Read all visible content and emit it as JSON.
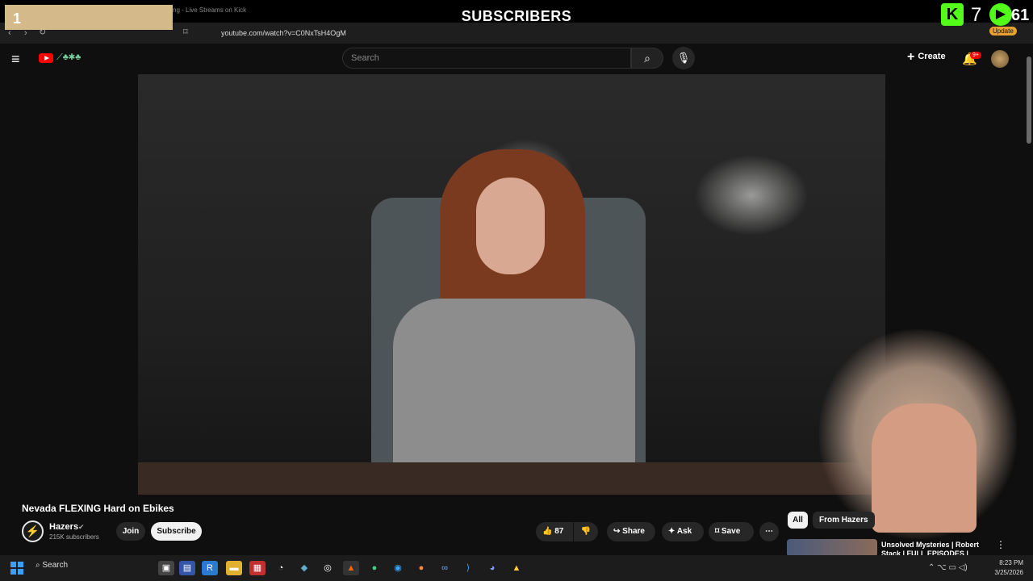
{
  "overlay": {
    "left_value": "1",
    "title": "SUBSCRIBERS",
    "kick_count": "7",
    "play_count": "61"
  },
  "browser": {
    "tab_title": "ng - Live Streams on Kick",
    "url": "youtube.com/watch?v=C0NxTsH4OgM",
    "update_label": "Update"
  },
  "header": {
    "search_placeholder": "Search",
    "create_label": "Create",
    "notification_badge": "9+"
  },
  "video": {
    "title": "Nevada FLEXING Hard on Ebikes"
  },
  "channel": {
    "name": "Hazers",
    "subscribers": "215K subscribers",
    "join_label": "Join",
    "subscribe_label": "Subscribe"
  },
  "actions": {
    "likes": "87",
    "share_label": "Share",
    "ask_label": "Ask",
    "save_label": "Save"
  },
  "recommendations": {
    "chips": [
      "All",
      "From Hazers"
    ],
    "first_title": "Unsolved Mysteries | Robert Stack | FULL EPISODES |"
  },
  "taskbar": {
    "search_label": "Search",
    "time": "8:23 PM",
    "date": "3/25/2026"
  },
  "icons": {
    "menu": "hamburger-icon",
    "search": "magnifier-icon",
    "mic": "microphone-icon",
    "bell": "bell-icon",
    "like": "thumbs-up-icon",
    "dislike": "thumbs-down-icon",
    "share": "share-arrow-icon",
    "ask": "sparkle-icon",
    "save": "bookmark-icon"
  },
  "colors": {
    "background": "#0f0f0f",
    "youtube_red": "#ff0000",
    "kick_green": "#53fc18",
    "overlay_tan": "#d4b98a"
  }
}
